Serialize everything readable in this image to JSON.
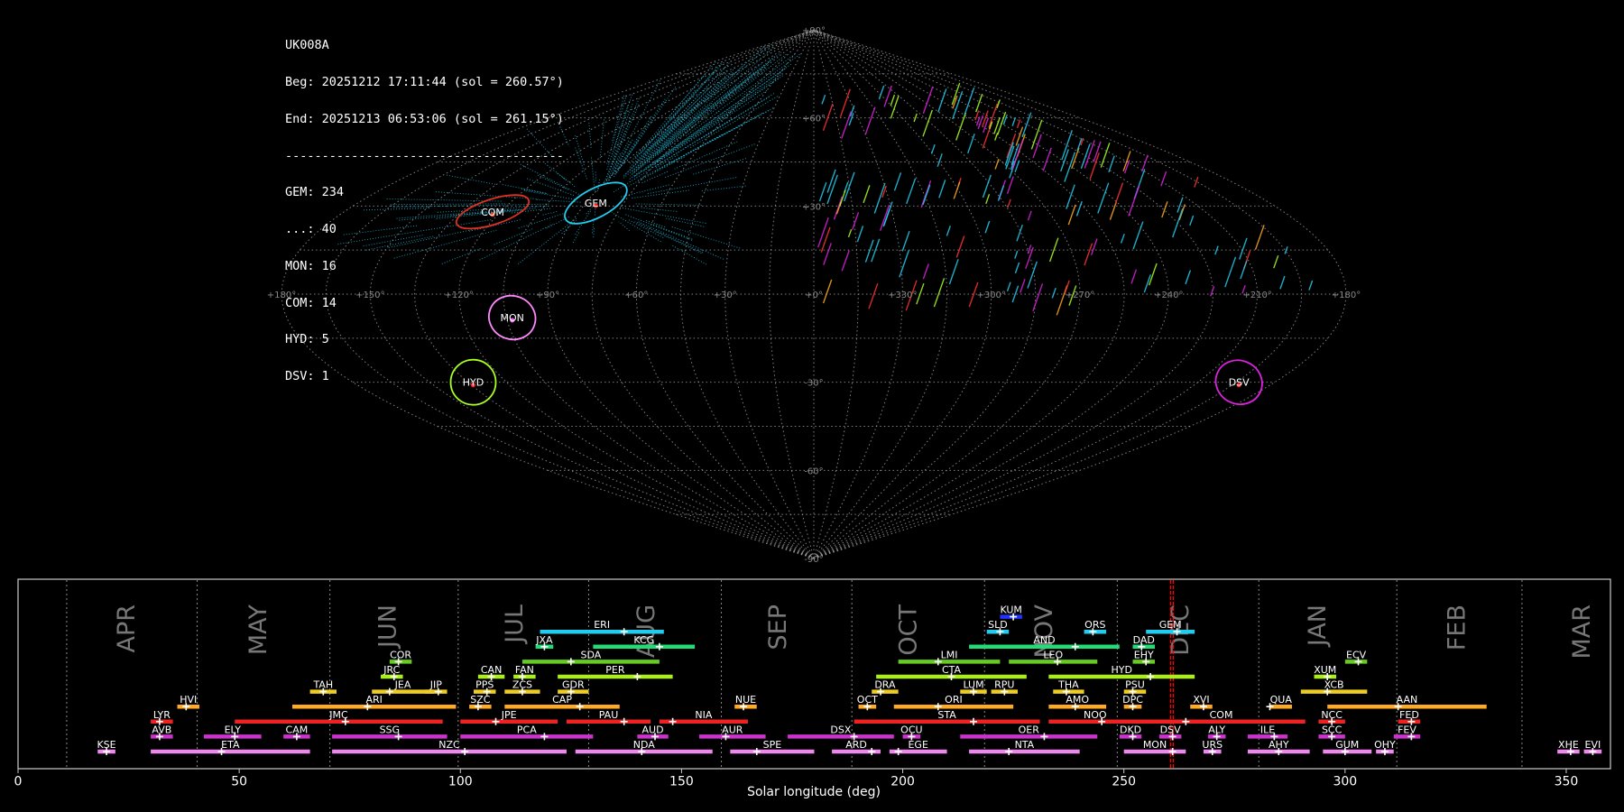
{
  "info": {
    "station": "UK008A",
    "begin": "Beg: 20251212 17:11:44 (sol = 260.57°)",
    "end": "End: 20251213 06:53:06 (sol = 261.15°)",
    "separator": "--------------------------------------",
    "counts": [
      "GEM: 234",
      "...: 40",
      "MON: 16",
      "COM: 14",
      "HYD: 5",
      "DSV: 1"
    ]
  },
  "sky_map": {
    "projection": "sinusoidal",
    "lon_labels": [
      "+180°",
      "+150°",
      "+120°",
      "+90°",
      "+60°",
      "+30°",
      "+0°",
      "+330°",
      "+300°",
      "+270°",
      "+240°",
      "+210°",
      "+180°"
    ],
    "lat_labels": [
      "+90°",
      "+60°",
      "+30°",
      "-30°",
      "-60°",
      "-90°"
    ],
    "radiants": [
      {
        "name": "COM",
        "color": "#ff4422",
        "ring": "#e03020"
      },
      {
        "name": "GEM",
        "color": "#ff2222",
        "ring": "#22ccee"
      },
      {
        "name": "MON",
        "color": "#ff66ff",
        "ring": "#ff88ff"
      },
      {
        "name": "HYD",
        "color": "#ff2222",
        "ring": "#aaff22"
      },
      {
        "name": "DSV",
        "color": "#ff2222",
        "ring": "#dd22dd"
      }
    ]
  },
  "chart_data": {
    "type": "timeline",
    "xlabel": "Solar longitude (deg)",
    "xlim": [
      0,
      360
    ],
    "x_ticks": [
      "0",
      "50",
      "100",
      "150",
      "200",
      "250",
      "300",
      "350"
    ],
    "months": [
      {
        "name": "APR",
        "sol": 24.8
      },
      {
        "name": "MAY",
        "sol": 54.6
      },
      {
        "name": "JUN",
        "sol": 83.8
      },
      {
        "name": "JUL",
        "sol": 112.5
      },
      {
        "name": "AUG",
        "sol": 142.3
      },
      {
        "name": "SEP",
        "sol": 172.0
      },
      {
        "name": "OCT",
        "sol": 201.5
      },
      {
        "name": "NOV",
        "sol": 232.2
      },
      {
        "name": "DEC",
        "sol": 263.0
      },
      {
        "name": "JAN",
        "sol": 294.0
      },
      {
        "name": "FEB",
        "sol": 325.5
      },
      {
        "name": "MAR",
        "sol": 353.8
      }
    ],
    "month_boundaries": [
      11,
      40.5,
      70.5,
      99.5,
      129,
      159,
      188.5,
      218.5,
      248.5,
      280.5,
      311.7,
      340
    ],
    "current_sol": [
      260.57,
      261.15
    ],
    "showers": [
      {
        "name": "KSE",
        "start": 18,
        "end": 22,
        "peak": 20,
        "row": 0,
        "color": "#ee88ee"
      },
      {
        "name": "ETA",
        "start": 30,
        "end": 66,
        "peak": 46,
        "row": 0,
        "color": "#ee88ee"
      },
      {
        "name": "NZC",
        "start": 71,
        "end": 124,
        "peak": 101,
        "row": 0,
        "color": "#ee88ee"
      },
      {
        "name": "NDA",
        "start": 126,
        "end": 157,
        "peak": 141,
        "row": 0,
        "color": "#ee88ee"
      },
      {
        "name": "SPE",
        "start": 161,
        "end": 180,
        "peak": 167,
        "row": 0,
        "color": "#ee88ee"
      },
      {
        "name": "ARD",
        "start": 184,
        "end": 195,
        "peak": 193,
        "row": 0,
        "color": "#ee88ee"
      },
      {
        "name": "EGE",
        "start": 197,
        "end": 210,
        "peak": 199,
        "row": 0,
        "color": "#ee88ee"
      },
      {
        "name": "NTA",
        "start": 215,
        "end": 240,
        "peak": 224,
        "row": 0,
        "color": "#ee88ee"
      },
      {
        "name": "MON",
        "start": 250,
        "end": 264,
        "peak": 261,
        "row": 0,
        "color": "#ee88ee"
      },
      {
        "name": "URS",
        "start": 268,
        "end": 272,
        "peak": 270,
        "row": 0,
        "color": "#ee88ee"
      },
      {
        "name": "AHY",
        "start": 278,
        "end": 292,
        "peak": 285,
        "row": 0,
        "color": "#ee88ee"
      },
      {
        "name": "GUM",
        "start": 295,
        "end": 306,
        "peak": 300,
        "row": 0,
        "color": "#ee88ee"
      },
      {
        "name": "OHY",
        "start": 307,
        "end": 311,
        "peak": 309,
        "row": 0,
        "color": "#ee88ee"
      },
      {
        "name": "XHE",
        "start": 348,
        "end": 353,
        "peak": 351,
        "row": 0,
        "color": "#ee88ee"
      },
      {
        "name": "EVI",
        "start": 354,
        "end": 358,
        "peak": 356,
        "row": 0,
        "color": "#ee88ee"
      },
      {
        "name": "AVB",
        "start": 30,
        "end": 35,
        "peak": 32,
        "row": 1,
        "color": "#cc33cc"
      },
      {
        "name": "ELY",
        "start": 42,
        "end": 55,
        "peak": 49,
        "row": 1,
        "color": "#cc33cc"
      },
      {
        "name": "CAM",
        "start": 60,
        "end": 66,
        "peak": 63,
        "row": 1,
        "color": "#cc33cc"
      },
      {
        "name": "SSG",
        "start": 71,
        "end": 97,
        "peak": 86,
        "row": 1,
        "color": "#cc33cc"
      },
      {
        "name": "PCA",
        "start": 100,
        "end": 130,
        "peak": 119,
        "row": 1,
        "color": "#cc33cc"
      },
      {
        "name": "AUD",
        "start": 140,
        "end": 147,
        "peak": 144,
        "row": 1,
        "color": "#cc33cc"
      },
      {
        "name": "AUR",
        "start": 154,
        "end": 169,
        "peak": 160,
        "row": 1,
        "color": "#cc33cc"
      },
      {
        "name": "DSX",
        "start": 174,
        "end": 198,
        "peak": 189,
        "row": 1,
        "color": "#cc33cc"
      },
      {
        "name": "OCU",
        "start": 200,
        "end": 204,
        "peak": 202,
        "row": 1,
        "color": "#cc33cc"
      },
      {
        "name": "OER",
        "start": 213,
        "end": 244,
        "peak": 232,
        "row": 1,
        "color": "#cc33cc"
      },
      {
        "name": "DKD",
        "start": 249,
        "end": 254,
        "peak": 252,
        "row": 1,
        "color": "#cc33cc"
      },
      {
        "name": "DSV",
        "start": 258,
        "end": 263,
        "peak": 261,
        "row": 1,
        "color": "#cc33cc"
      },
      {
        "name": "ALY",
        "start": 269,
        "end": 273,
        "peak": 271,
        "row": 1,
        "color": "#cc33cc"
      },
      {
        "name": "ILE",
        "start": 278,
        "end": 287,
        "peak": 284,
        "row": 1,
        "color": "#cc33cc"
      },
      {
        "name": "SCC",
        "start": 294,
        "end": 300,
        "peak": 297,
        "row": 1,
        "color": "#cc33cc"
      },
      {
        "name": "FEV",
        "start": 311,
        "end": 317,
        "peak": 315,
        "row": 1,
        "color": "#cc33cc"
      },
      {
        "name": "LYR",
        "start": 30,
        "end": 35,
        "peak": 32,
        "row": 2,
        "color": "#ee2222"
      },
      {
        "name": "JMC",
        "start": 49,
        "end": 96,
        "peak": 74,
        "row": 2,
        "color": "#ee2222"
      },
      {
        "name": "JPE",
        "start": 100,
        "end": 122,
        "peak": 108,
        "row": 2,
        "color": "#ee2222"
      },
      {
        "name": "PAU",
        "start": 124,
        "end": 143,
        "peak": 137,
        "row": 2,
        "color": "#ee2222"
      },
      {
        "name": "NIA",
        "start": 145,
        "end": 165,
        "peak": 148,
        "row": 2,
        "color": "#ee2222"
      },
      {
        "name": "STA",
        "start": 189,
        "end": 231,
        "peak": 216,
        "row": 2,
        "color": "#ee2222"
      },
      {
        "name": "NOO",
        "start": 233,
        "end": 254,
        "peak": 245,
        "row": 2,
        "color": "#ee2222"
      },
      {
        "name": "COM",
        "start": 253,
        "end": 291,
        "peak": 264,
        "row": 2,
        "color": "#ee2222"
      },
      {
        "name": "NCC",
        "start": 294,
        "end": 300,
        "peak": 297,
        "row": 2,
        "color": "#ee2222"
      },
      {
        "name": "FED",
        "start": 312,
        "end": 317,
        "peak": 315,
        "row": 2,
        "color": "#ee2222"
      },
      {
        "name": "HVI",
        "start": 36,
        "end": 41,
        "peak": 38,
        "row": 3,
        "color": "#ffaa22"
      },
      {
        "name": "ARI",
        "start": 62,
        "end": 99,
        "peak": 79,
        "row": 3,
        "color": "#ffaa22"
      },
      {
        "name": "SZC",
        "start": 102,
        "end": 107,
        "peak": 104,
        "row": 3,
        "color": "#ffaa22"
      },
      {
        "name": "CAP",
        "start": 110,
        "end": 136,
        "peak": 127,
        "row": 3,
        "color": "#ffaa22"
      },
      {
        "name": "NUE",
        "start": 162,
        "end": 167,
        "peak": 164,
        "row": 3,
        "color": "#ffaa22"
      },
      {
        "name": "OCT",
        "start": 190,
        "end": 194,
        "peak": 192,
        "row": 3,
        "color": "#ffaa22"
      },
      {
        "name": "ORI",
        "start": 198,
        "end": 225,
        "peak": 208,
        "row": 3,
        "color": "#ffaa22"
      },
      {
        "name": "AMO",
        "start": 233,
        "end": 246,
        "peak": 239,
        "row": 3,
        "color": "#ffaa22"
      },
      {
        "name": "DPC",
        "start": 250,
        "end": 254,
        "peak": 252,
        "row": 3,
        "color": "#ffaa22"
      },
      {
        "name": "XVI",
        "start": 265,
        "end": 270,
        "peak": 268,
        "row": 3,
        "color": "#ffaa22"
      },
      {
        "name": "QUA",
        "start": 283,
        "end": 288,
        "peak": 283,
        "row": 3,
        "color": "#ffaa22"
      },
      {
        "name": "AAN",
        "start": 296,
        "end": 332,
        "peak": 312,
        "row": 3,
        "color": "#ffaa22"
      },
      {
        "name": "TAH",
        "start": 66,
        "end": 72,
        "peak": 69,
        "row": 4,
        "color": "#eecc22"
      },
      {
        "name": "JEA",
        "start": 80,
        "end": 94,
        "peak": 84,
        "row": 4,
        "color": "#eecc22"
      },
      {
        "name": "JIP",
        "start": 92,
        "end": 97,
        "peak": 95,
        "row": 4,
        "color": "#eecc22"
      },
      {
        "name": "PPS",
        "start": 103,
        "end": 108,
        "peak": 106,
        "row": 4,
        "color": "#eecc22"
      },
      {
        "name": "ZCS",
        "start": 110,
        "end": 118,
        "peak": 114,
        "row": 4,
        "color": "#eecc22"
      },
      {
        "name": "GDR",
        "start": 122,
        "end": 129,
        "peak": 125,
        "row": 4,
        "color": "#eecc22"
      },
      {
        "name": "DRA",
        "start": 193,
        "end": 199,
        "peak": 195,
        "row": 4,
        "color": "#eecc22"
      },
      {
        "name": "LUM",
        "start": 213,
        "end": 219,
        "peak": 216,
        "row": 4,
        "color": "#eecc22"
      },
      {
        "name": "RPU",
        "start": 220,
        "end": 226,
        "peak": 223,
        "row": 4,
        "color": "#eecc22"
      },
      {
        "name": "THA",
        "start": 234,
        "end": 241,
        "peak": 237,
        "row": 4,
        "color": "#eecc22"
      },
      {
        "name": "PSU",
        "start": 250,
        "end": 255,
        "peak": 252,
        "row": 4,
        "color": "#eecc22"
      },
      {
        "name": "XCB",
        "start": 290,
        "end": 305,
        "peak": 296,
        "row": 4,
        "color": "#eecc22"
      },
      {
        "name": "JRC",
        "start": 82,
        "end": 87,
        "peak": 85,
        "row": 5,
        "color": "#aaee22"
      },
      {
        "name": "CAN",
        "start": 104,
        "end": 110,
        "peak": 107,
        "row": 5,
        "color": "#aaee22"
      },
      {
        "name": "FAN",
        "start": 112,
        "end": 117,
        "peak": 114,
        "row": 5,
        "color": "#aaee22"
      },
      {
        "name": "PER",
        "start": 122,
        "end": 148,
        "peak": 140,
        "row": 5,
        "color": "#aaee22"
      },
      {
        "name": "CTA",
        "start": 194,
        "end": 228,
        "peak": 211,
        "row": 5,
        "color": "#aaee22"
      },
      {
        "name": "HYD",
        "start": 233,
        "end": 266,
        "peak": 256,
        "row": 5,
        "color": "#aaee22"
      },
      {
        "name": "XUM",
        "start": 293,
        "end": 298,
        "peak": 296,
        "row": 5,
        "color": "#aaee22"
      },
      {
        "name": "COR",
        "start": 84,
        "end": 89,
        "peak": 86,
        "row": 6,
        "color": "#66cc22"
      },
      {
        "name": "SDA",
        "start": 114,
        "end": 145,
        "peak": 125,
        "row": 6,
        "color": "#66cc22"
      },
      {
        "name": "LMI",
        "start": 199,
        "end": 222,
        "peak": 208,
        "row": 6,
        "color": "#66cc22"
      },
      {
        "name": "LEO",
        "start": 224,
        "end": 244,
        "peak": 235,
        "row": 6,
        "color": "#66cc22"
      },
      {
        "name": "EHY",
        "start": 252,
        "end": 257,
        "peak": 255,
        "row": 6,
        "color": "#66cc22"
      },
      {
        "name": "ECV",
        "start": 300,
        "end": 305,
        "peak": 303,
        "row": 6,
        "color": "#66cc22"
      },
      {
        "name": "JXA",
        "start": 117,
        "end": 121,
        "peak": 119,
        "row": 7,
        "color": "#22dd77"
      },
      {
        "name": "KCG",
        "start": 130,
        "end": 153,
        "peak": 145,
        "row": 7,
        "color": "#22dd77"
      },
      {
        "name": "AND",
        "start": 215,
        "end": 249,
        "peak": 239,
        "row": 7,
        "color": "#22dd77"
      },
      {
        "name": "DAD",
        "start": 252,
        "end": 257,
        "peak": 254,
        "row": 7,
        "color": "#22dd77"
      },
      {
        "name": "ERI",
        "start": 118,
        "end": 146,
        "peak": 137,
        "row": 8,
        "color": "#22ccee"
      },
      {
        "name": "SLD",
        "start": 219,
        "end": 224,
        "peak": 222,
        "row": 8,
        "color": "#22ccee"
      },
      {
        "name": "ORS",
        "start": 241,
        "end": 246,
        "peak": 243,
        "row": 8,
        "color": "#22ccee"
      },
      {
        "name": "GEM",
        "start": 255,
        "end": 266,
        "peak": 262,
        "row": 8,
        "color": "#22ccee"
      },
      {
        "name": "KUM",
        "start": 222,
        "end": 227,
        "peak": 225,
        "row": 9,
        "color": "#2233ff"
      }
    ]
  },
  "colors": {
    "background": "#000000",
    "grid": "#aaaaaa",
    "marker": "#ff0000"
  }
}
